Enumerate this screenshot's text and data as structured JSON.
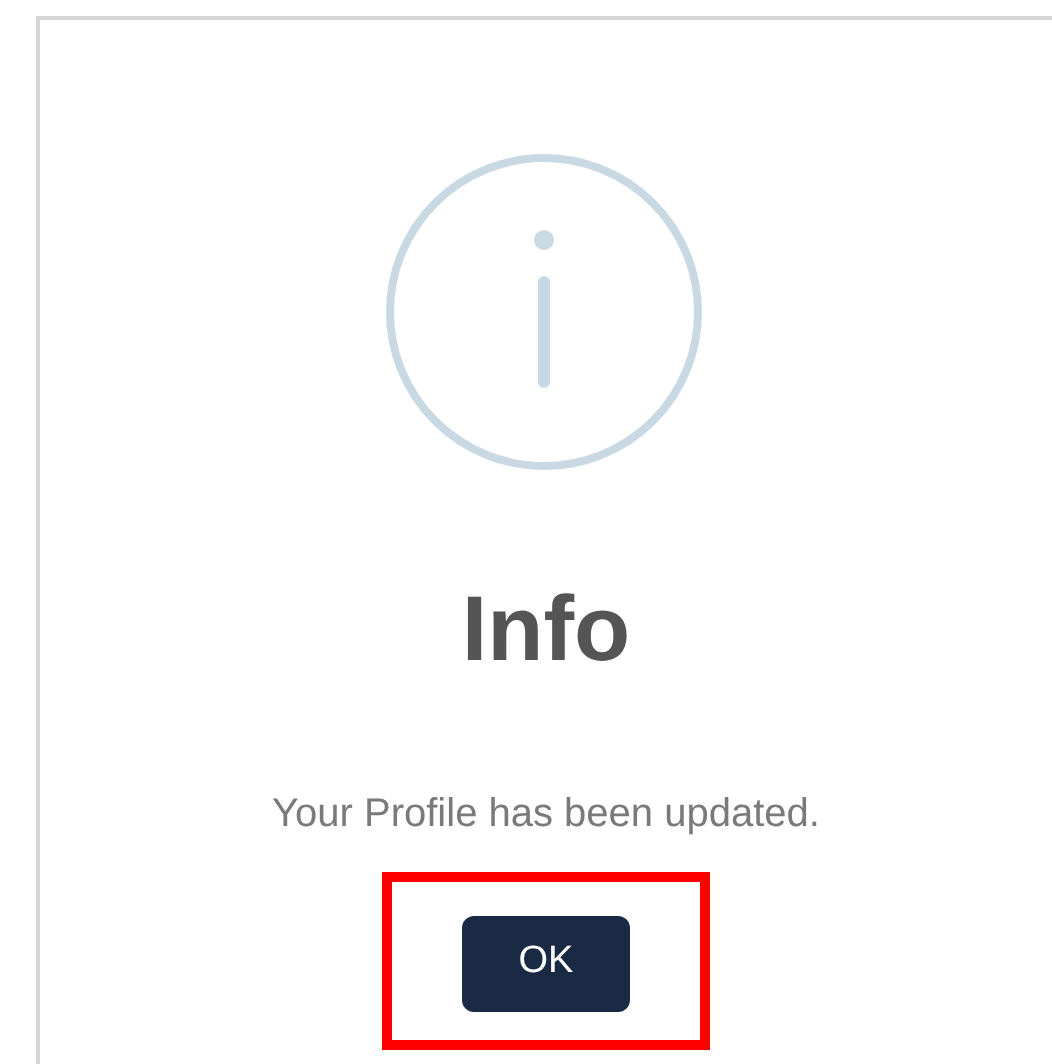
{
  "dialog": {
    "title": "Info",
    "message": "Your Profile has been updated.",
    "button": "OK"
  }
}
